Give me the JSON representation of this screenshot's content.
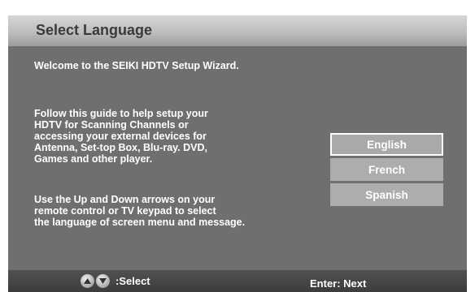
{
  "header": {
    "title": "Select Language"
  },
  "content": {
    "welcome": "Welcome to the SEIKI HDTV Setup Wizard.",
    "guide": "Follow this guide to help setup your\nHDTV for Scanning Channels or\naccessing your external devices for\nAntenna, Set-top Box, Blu-ray. DVD,\nGames and other player.",
    "instructions": "Use the Up and Down arrows on your\nremote control or TV keypad to select\nthe language of screen menu and message."
  },
  "languages": {
    "selected": "English",
    "options": [
      "English",
      "French",
      "Spanish"
    ]
  },
  "footer": {
    "select_label": ":Select",
    "enter_label": "Enter: Next",
    "icons": [
      "arrow-up-icon",
      "arrow-down-icon"
    ]
  },
  "colors": {
    "panel": "#6f6f6f",
    "button": "#adadad",
    "text": "#ffffff"
  }
}
